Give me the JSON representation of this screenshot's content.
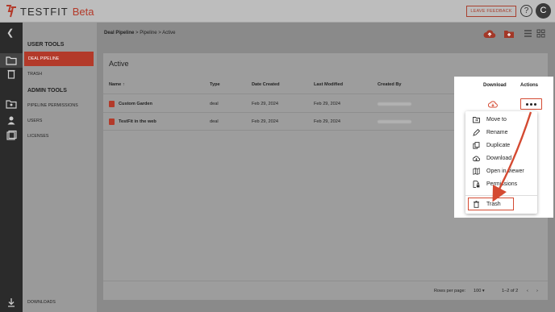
{
  "app": {
    "logo_text": "TESTFIT",
    "beta": "Beta"
  },
  "topbar": {
    "feedback_label": "LEAVE FEEDBACK",
    "help_glyph": "?",
    "avatar_initial": "C"
  },
  "sidebar": {
    "user_tools_heading": "USER TOOLS",
    "user_items": [
      "DEAL PIPELINE",
      "TRASH"
    ],
    "admin_tools_heading": "ADMIN TOOLS",
    "admin_items": [
      "PIPELINE PERMISSIONS",
      "USERS",
      "LICENSES"
    ],
    "downloads": "DOWNLOADS"
  },
  "breadcrumb": {
    "root": "Deal Pipeline",
    "sep": ">",
    "mid": "Pipeline",
    "current": "Active"
  },
  "panel": {
    "title": "Active",
    "columns": [
      "Name",
      "Type",
      "Date Created",
      "Last Modified",
      "Created By",
      "Download",
      "Actions"
    ],
    "sort_indicator": "↑",
    "rows": [
      {
        "name": "Custom Garden",
        "type": "deal",
        "created": "Feb 29, 2024",
        "modified": "Feb 29, 2024"
      },
      {
        "name": "TestFit in the web",
        "type": "deal",
        "created": "Feb 29, 2024",
        "modified": "Feb 29, 2024"
      }
    ],
    "rows_per_page_label": "Rows per page:",
    "rows_per_page_value": "100",
    "pagination": "1–2 of 2"
  },
  "menu": {
    "items": [
      "Move to",
      "Rename",
      "Duplicate",
      "Download",
      "Open in viewer",
      "Permissions",
      "Trash"
    ]
  },
  "colors": {
    "brand": "#b33a2a",
    "highlight": "#d44a32"
  }
}
